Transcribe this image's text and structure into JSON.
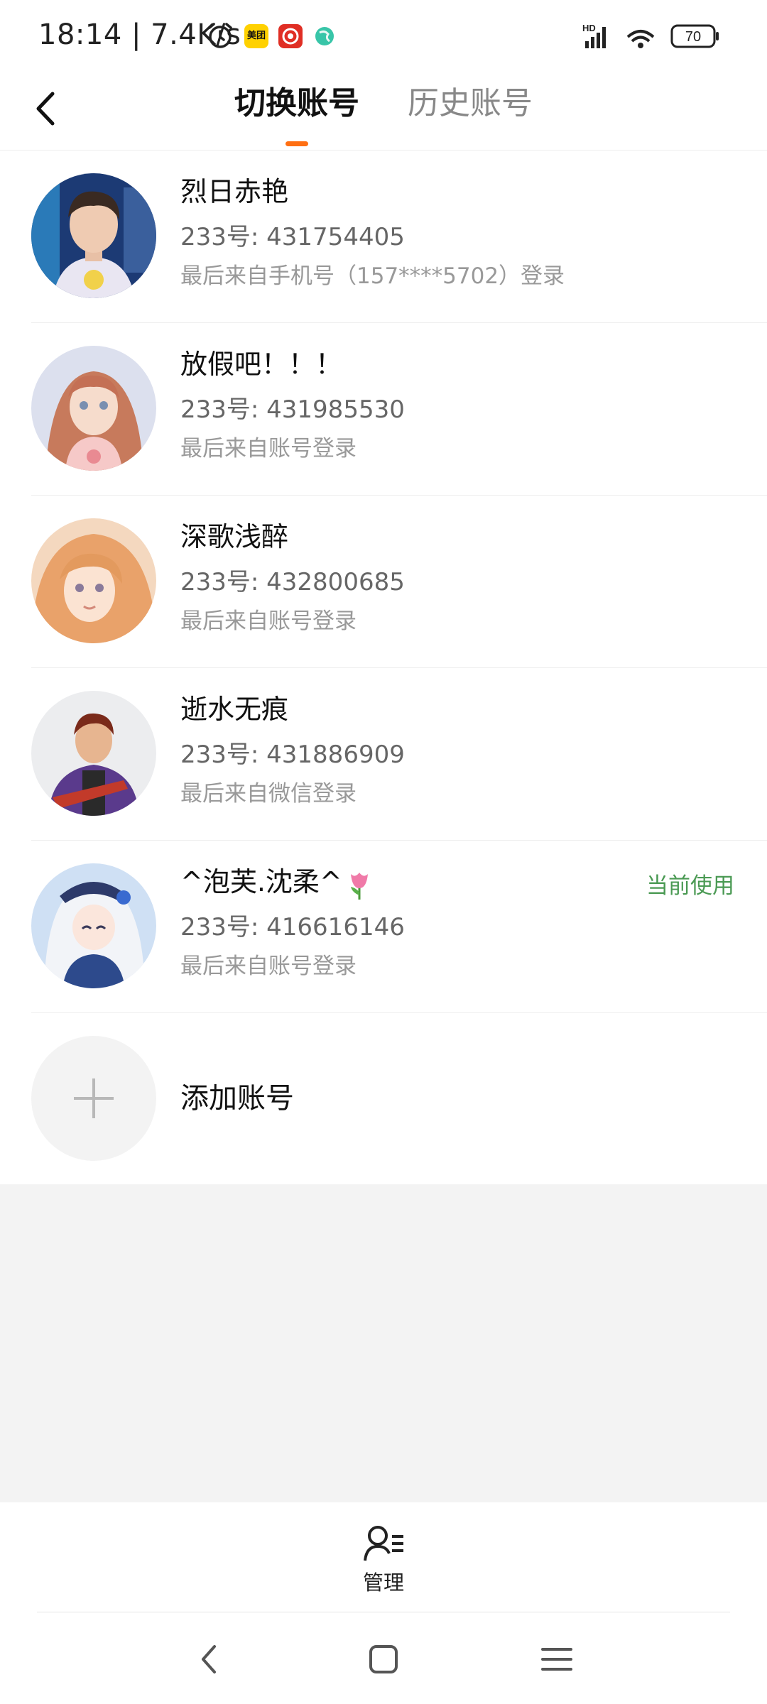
{
  "status_bar": {
    "time": "18:14 | 7.4K/s",
    "meituan_label": "美团",
    "network": "HD",
    "battery": "70"
  },
  "header": {
    "tabs": [
      {
        "label": "切换账号",
        "active": true
      },
      {
        "label": "历史账号",
        "active": false
      }
    ],
    "accent_color": "#ff6f12"
  },
  "accounts": [
    {
      "name": "烈日赤艳",
      "id": "233号: 431754405",
      "login_from": "最后来自手机号（157****5702）登录",
      "current": false
    },
    {
      "name": "放假吧！！！",
      "id": "233号: 431985530",
      "login_from": "最后来自账号登录",
      "current": false
    },
    {
      "name": "深歌浅醉",
      "id": "233号: 432800685",
      "login_from": "最后来自账号登录",
      "current": false
    },
    {
      "name": "逝水无痕",
      "id": "233号: 431886909",
      "login_from": "最后来自微信登录",
      "current": false
    },
    {
      "name": "^泡芙.沈柔^",
      "id": "233号: 416616146",
      "login_from": "最后来自账号登录",
      "current": true
    }
  ],
  "current_badge": "当前使用",
  "add_account_label": "添加账号",
  "manage_label": "管理",
  "icons": {
    "back": "chevron-left-icon",
    "add": "plus-icon",
    "manage": "user-list-icon",
    "name_emoji": "tulip-icon"
  },
  "colors": {
    "current_green": "#4b9a54",
    "gray_background": "#f3f3f3"
  }
}
